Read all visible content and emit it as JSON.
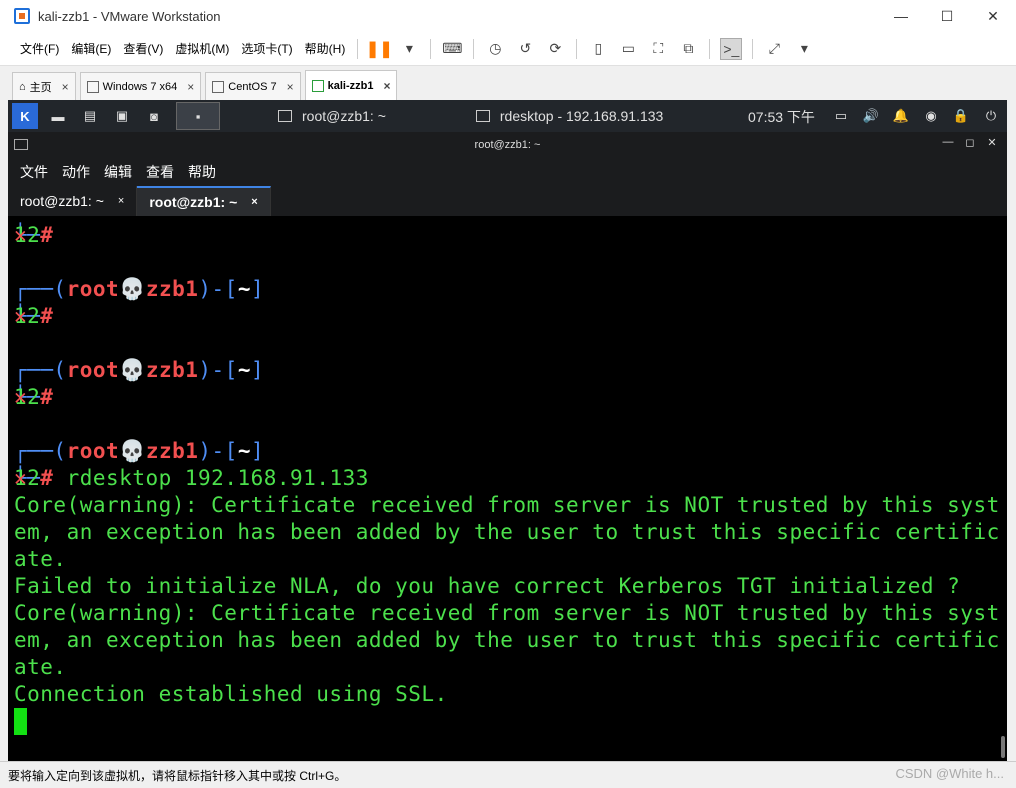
{
  "window": {
    "title": "kali-zzb1 - VMware Workstation",
    "ctrl_min": "—",
    "ctrl_max": "☐",
    "ctrl_close": "✕"
  },
  "menubar": {
    "items": [
      "文件(F)",
      "编辑(E)",
      "查看(V)",
      "虚拟机(M)",
      "选项卡(T)",
      "帮助(H)"
    ]
  },
  "vm_tabs": [
    {
      "label": "主页",
      "close": "×"
    },
    {
      "label": "Windows 7 x64",
      "close": "×"
    },
    {
      "label": "CentOS 7",
      "close": "×"
    },
    {
      "label": "kali-zzb1",
      "close": "×"
    }
  ],
  "kali_panel": {
    "task1": "root@zzb1: ~",
    "task2": "rdesktop - 192.168.91.133",
    "clock": "07:53 下午"
  },
  "terminal": {
    "title": "root@zzb1: ~",
    "menu": [
      "文件",
      "动作",
      "编辑",
      "查看",
      "帮助"
    ],
    "tabs": [
      "root@zzb1: ~",
      "root@zzb1: ~"
    ],
    "tab_close": "×",
    "prompt": {
      "open": "┌──(",
      "user": "root",
      "skull": "💀",
      "host": "zzb1",
      "close": ")-[",
      "dir": "~",
      "end": "]",
      "hash_prefix": "└─",
      "hash": "#"
    },
    "prompt_count": "12",
    "prompt_x": "✕",
    "command": "rdesktop 192.168.91.133",
    "output": [
      "Core(warning): Certificate received from server is NOT trusted by this syst",
      "em, an exception has been added by the user to trust this specific certific",
      "ate.",
      "Failed to initialize NLA, do you have correct Kerberos TGT initialized ?",
      "Core(warning): Certificate received from server is NOT trusted by this syst",
      "em, an exception has been added by the user to trust this specific certific",
      "ate.",
      "Connection established using SSL."
    ]
  },
  "statusbar": {
    "text": "要将输入定向到该虚拟机，请将鼠标指针移入其中或按 Ctrl+G。",
    "watermark": "CSDN @White h..."
  },
  "colors": {
    "prompt_blue": "#4f8ef5",
    "prompt_red": "#f25050",
    "output_green": "#4ce04c"
  }
}
